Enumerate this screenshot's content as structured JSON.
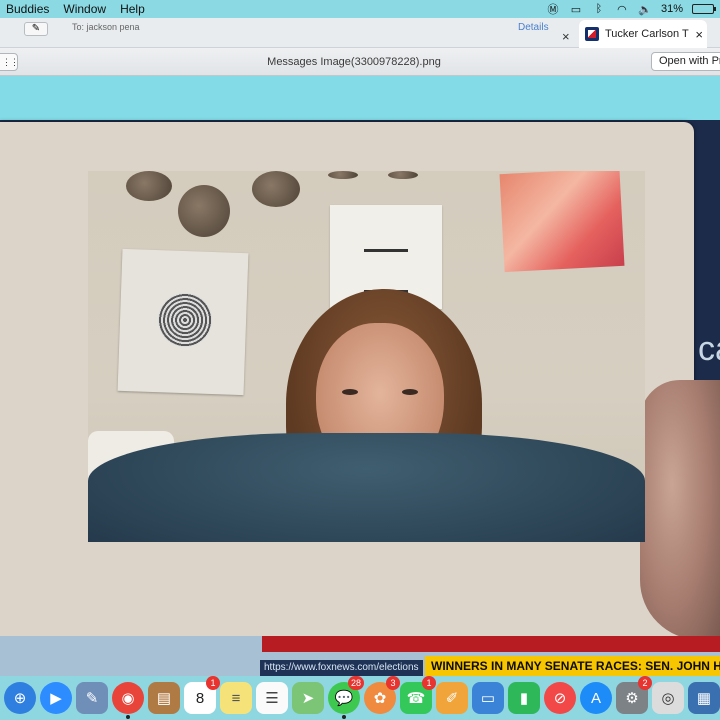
{
  "menubar": {
    "items": [
      "Buddies",
      "Window",
      "Help"
    ],
    "status": {
      "battery_text": "31%",
      "battery_level": 0.31,
      "icons": [
        "malwarebytes-icon",
        "airplay-icon",
        "bluetooth-icon",
        "wifi-icon",
        "volume-icon"
      ]
    }
  },
  "browser_tabstrip": {
    "to_text": "To: jackson pena",
    "details_link": "Details",
    "active_tab_title": "Tucker Carlson T",
    "close_glyph": "×"
  },
  "quicklook": {
    "title": "Messages Image(3300978228).png",
    "open_button_label": "Open with Pr"
  },
  "photo": {
    "description_icon": "webcam-photo"
  },
  "background_site": {
    "partial_text": "ca",
    "status_url": "https://www.foxnews.com/elections",
    "ticker_text": "WINNERS IN MANY SENATE RACES: SEN. JOHN HOE"
  },
  "dock": {
    "apps": [
      {
        "name": "safari-icon",
        "color": "#2f7fe0",
        "glyph": "⊕",
        "round": true
      },
      {
        "name": "zoom-icon",
        "color": "#2d8cff",
        "glyph": "▶",
        "round": true
      },
      {
        "name": "preview-icon",
        "color": "#6f8fb8",
        "glyph": "✎",
        "round": false
      },
      {
        "name": "chrome-icon",
        "color": "#e8443a",
        "glyph": "◉",
        "round": true,
        "dot": true
      },
      {
        "name": "notebook-icon",
        "color": "#b07a45",
        "glyph": "▤",
        "round": false
      },
      {
        "name": "calendar-icon",
        "color": "#ffffff",
        "glyph": "8",
        "glyph_color": "#222",
        "round": false,
        "badge": "1"
      },
      {
        "name": "notes-icon",
        "color": "#f5e37a",
        "glyph": "≡",
        "glyph_color": "#555",
        "round": false
      },
      {
        "name": "reminders-icon",
        "color": "#fafafa",
        "glyph": "☰",
        "glyph_color": "#444",
        "round": false
      },
      {
        "name": "maps-icon",
        "color": "#7cc577",
        "glyph": "➤",
        "round": false
      },
      {
        "name": "messages-icon",
        "color": "#3ec84f",
        "glyph": "💬",
        "round": true,
        "badge": "28",
        "dot": true
      },
      {
        "name": "photos-icon",
        "color": "#f08a3e",
        "glyph": "✿",
        "round": true,
        "badge": "3"
      },
      {
        "name": "facetime-icon",
        "color": "#34c759",
        "glyph": "☎",
        "round": false,
        "badge": "1"
      },
      {
        "name": "pages-icon",
        "color": "#f0a43a",
        "glyph": "✐",
        "round": false
      },
      {
        "name": "keynote-icon",
        "color": "#3b83d6",
        "glyph": "▭",
        "round": false
      },
      {
        "name": "numbers-icon",
        "color": "#2fb85a",
        "glyph": "▮",
        "round": false
      },
      {
        "name": "news-icon",
        "color": "#f24848",
        "glyph": "⊘",
        "round": true
      },
      {
        "name": "app-store-icon",
        "color": "#1d8cf8",
        "glyph": "A",
        "round": true
      },
      {
        "name": "system-preferences-icon",
        "color": "#7d8287",
        "glyph": "⚙",
        "round": false,
        "badge": "2"
      },
      {
        "name": "screenshot-icon",
        "color": "#dcdcdc",
        "glyph": "◎",
        "glyph_color": "#333",
        "round": false
      },
      {
        "name": "extra-app-icon",
        "color": "#3a6fb0",
        "glyph": "▦",
        "round": false
      }
    ]
  }
}
